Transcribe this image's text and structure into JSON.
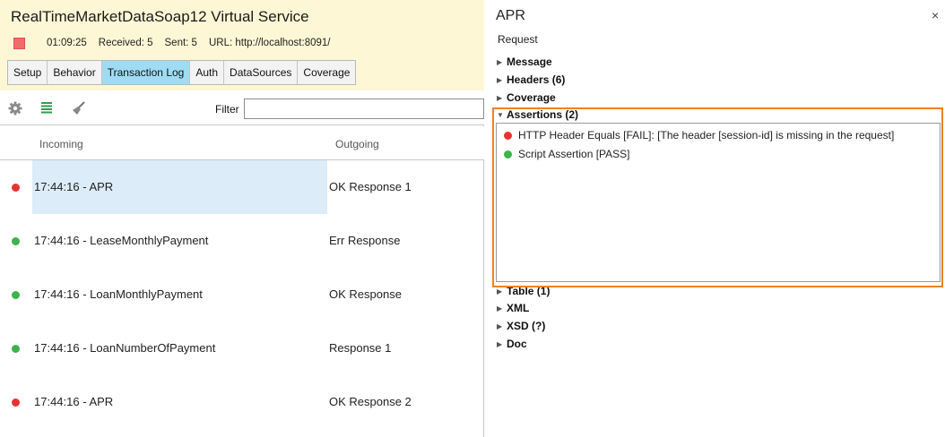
{
  "colors": {
    "fail": "#e83232",
    "pass": "#3cb44b",
    "accent_tab": "#9fdcf3",
    "highlight": "#f0821e"
  },
  "service": {
    "title": "RealTimeMarketDataSoap12 Virtual Service",
    "uptime": "01:09:25",
    "received": "Received: 5",
    "sent": "Sent: 5",
    "url": "URL: http://localhost:8091/"
  },
  "tabs": [
    {
      "label": "Setup"
    },
    {
      "label": "Behavior"
    },
    {
      "label": "Transaction Log"
    },
    {
      "label": "Auth"
    },
    {
      "label": "DataSources"
    },
    {
      "label": "Coverage"
    }
  ],
  "toolbar": {
    "icons": [
      "gear-icon",
      "list-icon",
      "broom-icon"
    ],
    "filter_label": "Filter",
    "filter_value": ""
  },
  "log": {
    "col_incoming": "Incoming",
    "col_outgoing": "Outgoing",
    "rows": [
      {
        "status": "fail",
        "incoming": "17:44:16 - APR",
        "outgoing": "OK Response 1"
      },
      {
        "status": "pass",
        "incoming": "17:44:16 - LeaseMonthlyPayment",
        "outgoing": "Err Response"
      },
      {
        "status": "pass",
        "incoming": "17:44:16 - LoanMonthlyPayment",
        "outgoing": "OK Response"
      },
      {
        "status": "pass",
        "incoming": "17:44:16 - LoanNumberOfPayment",
        "outgoing": "Response 1"
      },
      {
        "status": "fail",
        "incoming": "17:44:16 - APR",
        "outgoing": "OK Response 2"
      }
    ]
  },
  "detail": {
    "title": "APR",
    "close": "×",
    "subtitle": "Request",
    "sections": {
      "message": "Message",
      "headers": "Headers (6)",
      "coverage": "Coverage",
      "assertions": "Assertions (2)",
      "table": "Table (1)",
      "xml": "XML",
      "xsd": "XSD (?)",
      "doc": "Doc"
    },
    "assertions": [
      {
        "status": "fail",
        "text": "HTTP Header Equals [FAIL]: [The header [session-id] is missing in the request]"
      },
      {
        "status": "pass",
        "text": "Script Assertion [PASS]"
      }
    ]
  }
}
